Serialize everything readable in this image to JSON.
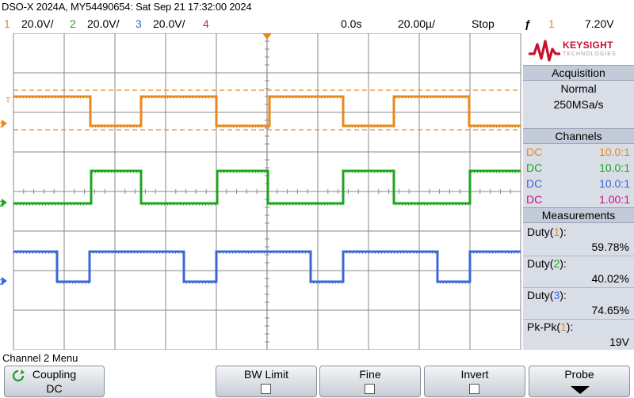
{
  "window_title": "DSO-X 2024A, MY54490654: Sat Sep 21 17:32:00 2024",
  "status_bar": {
    "ch1_num": "1",
    "ch1_scale": "20.0V/",
    "ch2_num": "2",
    "ch2_scale": "20.0V/",
    "ch3_num": "3",
    "ch3_scale": "20.0V/",
    "ch4_num": "4",
    "time_delay": "0.0s",
    "time_scale": "20.00µ/",
    "run_state": "Stop",
    "trigger_slope": "ƒ",
    "trigger_source": "1",
    "trigger_level": "7.20V"
  },
  "colors": {
    "ch1": "#e8891b",
    "ch2": "#1ea51e",
    "ch3": "#3a67d8",
    "ch4": "#c6168a",
    "grid": "#8a8a8a",
    "brand": "#c8102e"
  },
  "brand": {
    "name": "KEYSIGHT",
    "sub": "TECHNOLOGIES"
  },
  "acquisition": {
    "heading": "Acquisition",
    "mode": "Normal",
    "rate": "250MSa/s"
  },
  "channels": {
    "heading": "Channels",
    "rows": [
      {
        "coupling": "DC",
        "probe": "10.0:1"
      },
      {
        "coupling": "DC",
        "probe": "10.0:1"
      },
      {
        "coupling": "DC",
        "probe": "10.0:1"
      },
      {
        "coupling": "DC",
        "probe": "1.00:1"
      }
    ]
  },
  "measurements": {
    "heading": "Measurements",
    "items": [
      {
        "name": "Duty(",
        "ch": "1",
        "close": "):",
        "value": "59.78%"
      },
      {
        "name": "Duty(",
        "ch": "2",
        "close": "):",
        "value": "40.02%"
      },
      {
        "name": "Duty(",
        "ch": "3",
        "close": "):",
        "value": "74.65%"
      },
      {
        "name": "Pk-Pk(",
        "ch": "1",
        "close": "):",
        "value": "19V"
      }
    ]
  },
  "menu_title": "Channel 2 Menu",
  "softkeys": {
    "coupling_label": "Coupling",
    "coupling_value": "DC",
    "bw_limit_label": "BW Limit",
    "fine_label": "Fine",
    "invert_label": "Invert",
    "probe_label": "Probe"
  },
  "markers": {
    "trigger": "T",
    "ch1": "1",
    "ch2": "2",
    "ch3": "3"
  }
}
